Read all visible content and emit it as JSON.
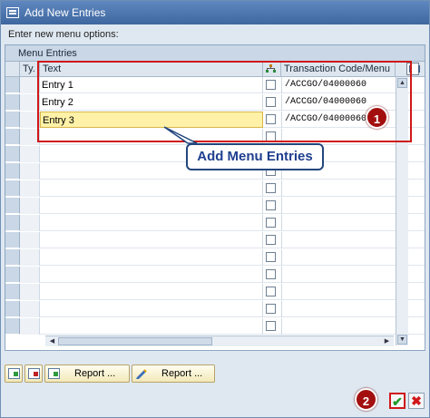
{
  "window": {
    "title": "Add New Entries"
  },
  "prompt": "Enter new menu options:",
  "panel": {
    "title": "Menu Entries"
  },
  "columns": {
    "type": "Ty.",
    "text": "Text",
    "code": "Transaction Code/Menu"
  },
  "rows": [
    {
      "text": "Entry 1",
      "code": "/ACCGO/04000060",
      "active": false
    },
    {
      "text": "Entry 2",
      "code": "/ACCGO/04000060",
      "active": false
    },
    {
      "text": "Entry 3",
      "code": "/ACCGO/04000060",
      "active": true
    },
    {
      "text": "",
      "code": ""
    },
    {
      "text": "",
      "code": ""
    },
    {
      "text": "",
      "code": ""
    },
    {
      "text": "",
      "code": ""
    },
    {
      "text": "",
      "code": ""
    },
    {
      "text": "",
      "code": ""
    },
    {
      "text": "",
      "code": ""
    },
    {
      "text": "",
      "code": ""
    },
    {
      "text": "",
      "code": ""
    },
    {
      "text": "",
      "code": ""
    },
    {
      "text": "",
      "code": ""
    },
    {
      "text": "",
      "code": ""
    }
  ],
  "annotations": {
    "callout": "Add Menu Entries",
    "badge1": "1",
    "badge2": "2",
    "color": "#d01818"
  },
  "toolbar": {
    "insert_row_icon": "insert-row-icon",
    "delete_row_icon": "delete-row-icon",
    "report_label_1": "Report ...",
    "report_label_2": "Report ..."
  },
  "actions": {
    "confirm_icon": "check-icon",
    "cancel_icon": "cancel-x-icon"
  }
}
